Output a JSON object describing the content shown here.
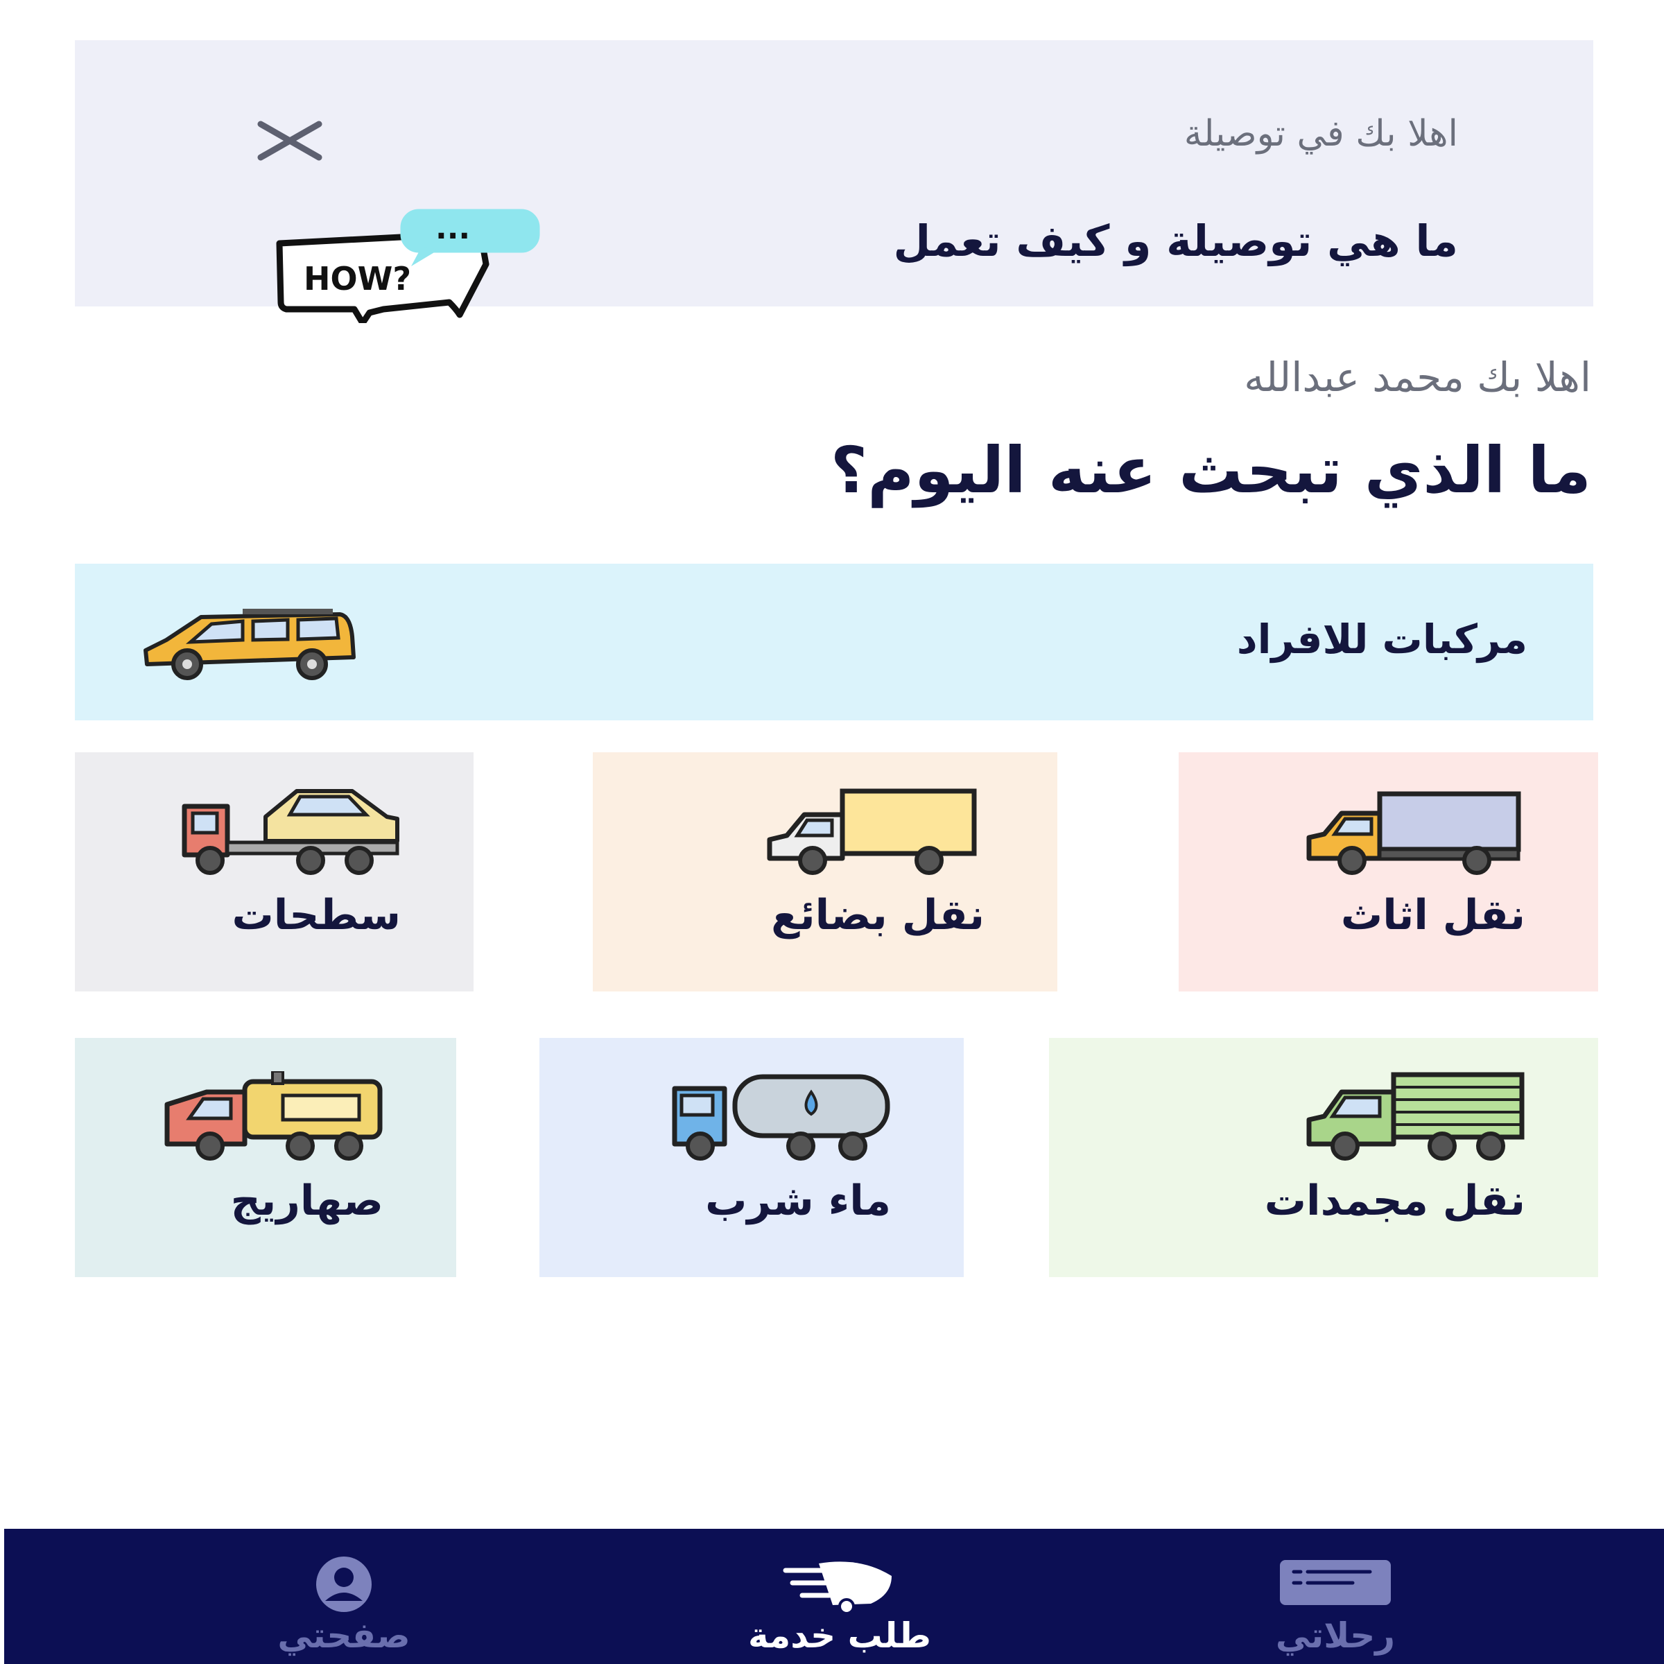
{
  "banner": {
    "small_text": "اهلا بك في توصيلة",
    "title": "ما هي توصيلة و كيف تعمل",
    "how_badge": "HOW?",
    "chat_dots": "...",
    "close_icon": "close-icon"
  },
  "greeting": {
    "welcome": "اهلا بك محمد عبدالله",
    "question": "ما الذي تبحث عنه اليوم؟"
  },
  "services": {
    "individuals": {
      "label": "مركبات للافراد",
      "icon": "car-icon",
      "color": "#dbf3fb"
    },
    "furniture": {
      "label": "نقل اثاث",
      "icon": "moving-truck-icon",
      "color": "#fde8e6"
    },
    "goods": {
      "label": "نقل بضائع",
      "icon": "cargo-truck-icon",
      "color": "#fcefe2"
    },
    "flatbed": {
      "label": "سطحات",
      "icon": "tow-truck-icon",
      "color": "#ededf0"
    },
    "frozen": {
      "label": "نقل مجمدات",
      "icon": "refrigerated-truck-icon",
      "color": "#eef8e8"
    },
    "water": {
      "label": "ماء شرب",
      "icon": "water-tanker-icon",
      "color": "#e4ecfb"
    },
    "tanker": {
      "label": "صهاريج",
      "icon": "fuel-tanker-icon",
      "color": "#e1eff0"
    }
  },
  "nav": {
    "profile": {
      "label": "صفحتي",
      "icon": "user-icon"
    },
    "request": {
      "label": "طلب خدمة",
      "icon": "fast-delivery-icon"
    },
    "trips": {
      "label": "رحلاتي",
      "icon": "card-list-icon"
    },
    "background": "#0c0f54"
  }
}
